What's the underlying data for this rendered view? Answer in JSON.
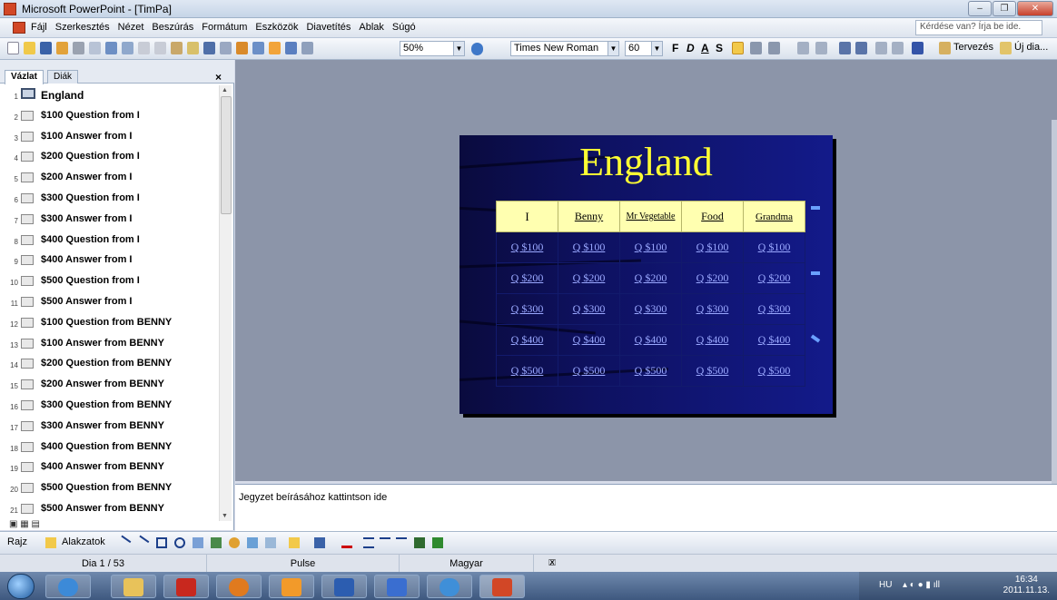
{
  "window": {
    "title": "Microsoft PowerPoint - [TimPa]"
  },
  "menubar": {
    "items": [
      "Fájl",
      "Szerkesztés",
      "Nézet",
      "Beszúrás",
      "Formátum",
      "Eszközök",
      "Diavetítés",
      "Ablak",
      "Súgó"
    ],
    "help_placeholder": "Kérdése van? Írja be ide."
  },
  "toolbar": {
    "zoom": "50%",
    "font_name": "Times New Roman",
    "font_size": "60",
    "bold": "F",
    "italic": "D",
    "underline": "A",
    "shadow": "S",
    "design_label": "Tervezés",
    "new_slide_label": "Új dia..."
  },
  "left_panel": {
    "tabs": [
      "Vázlat",
      "Diák"
    ],
    "slides": [
      {
        "num": "1",
        "title": "England"
      },
      {
        "num": "2",
        "title": "$100 Question from I"
      },
      {
        "num": "3",
        "title": "$100 Answer from I"
      },
      {
        "num": "4",
        "title": "$200 Question from I"
      },
      {
        "num": "5",
        "title": "$200 Answer from I"
      },
      {
        "num": "6",
        "title": "$300 Question from I"
      },
      {
        "num": "7",
        "title": "$300 Answer from I"
      },
      {
        "num": "8",
        "title": "$400 Question from I"
      },
      {
        "num": "9",
        "title": "$400 Answer from I"
      },
      {
        "num": "10",
        "title": "$500 Question from I"
      },
      {
        "num": "11",
        "title": "$500 Answer from I"
      },
      {
        "num": "12",
        "title": "$100 Question from BENNY"
      },
      {
        "num": "13",
        "title": "$100 Answer from BENNY"
      },
      {
        "num": "14",
        "title": "$200 Question from BENNY"
      },
      {
        "num": "15",
        "title": "$200 Answer from BENNY"
      },
      {
        "num": "16",
        "title": "$300 Question from BENNY"
      },
      {
        "num": "17",
        "title": "$300 Answer from BENNY"
      },
      {
        "num": "18",
        "title": "$400 Question from BENNY"
      },
      {
        "num": "19",
        "title": "$400 Answer from BENNY"
      },
      {
        "num": "20",
        "title": "$500 Question from BENNY"
      },
      {
        "num": "21",
        "title": "$500 Answer from BENNY"
      }
    ]
  },
  "slide": {
    "title": "England",
    "columns": [
      "I",
      "Benny",
      "Mr Vegetable",
      "Food",
      "Grandma"
    ],
    "rows": [
      [
        "Q $100",
        "Q $100",
        "Q $100",
        "Q $100",
        "Q $100"
      ],
      [
        "Q $200",
        "Q $200",
        "Q $200",
        "Q $200",
        "Q $200"
      ],
      [
        "Q $300",
        "Q $300",
        "Q $300",
        "Q $300",
        "Q $300"
      ],
      [
        "Q $400",
        "Q $400",
        "Q $400",
        "Q $400",
        "Q $400"
      ],
      [
        "Q $500",
        "Q $500",
        "Q $500",
        "Q $500",
        "Q $500"
      ]
    ]
  },
  "notes": {
    "placeholder": "Jegyzet beírásához kattintson ide"
  },
  "drawbar": {
    "draw_label": "Rajz",
    "autoshapes_label": "Alakzatok"
  },
  "status": {
    "slide": "Dia 1 / 53",
    "design": "Pulse",
    "language": "Magyar"
  },
  "taskbar": {
    "lang": "HU",
    "time": "16:34",
    "date": "2011.11.13."
  },
  "colors": {
    "slide_title": "#ffff33",
    "header_cell": "#ffffb0",
    "link": "#9aa8ff"
  }
}
